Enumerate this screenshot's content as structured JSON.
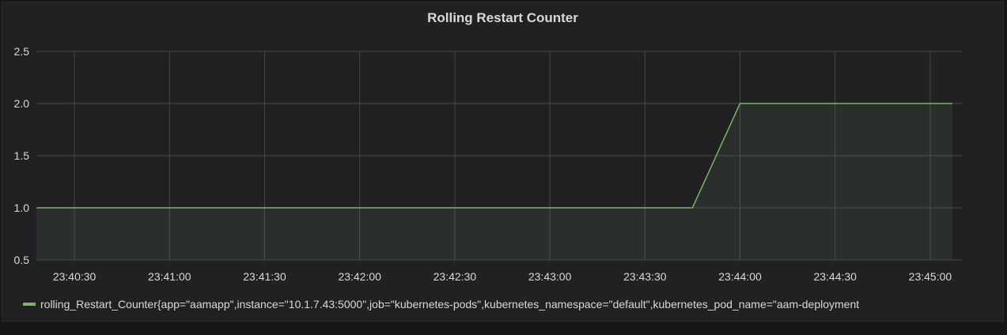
{
  "panel": {
    "title": "Rolling Restart Counter"
  },
  "colors": {
    "series": "#7eb26d",
    "grid": "#464648",
    "text": "#d8d9da"
  },
  "chart_data": {
    "type": "area",
    "title": "Rolling Restart Counter",
    "xlabel": "",
    "ylabel": "",
    "ylim": [
      0.5,
      2.5
    ],
    "y_ticks": [
      "0.5",
      "1.0",
      "1.5",
      "2.0",
      "2.5"
    ],
    "x_ticks": [
      "23:40:30",
      "23:41:00",
      "23:41:30",
      "23:42:00",
      "23:42:30",
      "23:43:00",
      "23:43:30",
      "23:44:00",
      "23:44:30",
      "23:45:00"
    ],
    "xlim": [
      "23:40:18",
      "23:45:10"
    ],
    "grid": true,
    "legend_position": "bottom",
    "series": [
      {
        "name": "rolling_Restart_Counter{app=\"aamapp\",instance=\"10.1.7.43:5000\",job=\"kubernetes-pods\",kubernetes_namespace=\"default\",kubernetes_pod_name=\"aam-deployment",
        "x": [
          "23:40:18",
          "23:43:45",
          "23:44:00",
          "23:45:07"
        ],
        "values": [
          1,
          1,
          2,
          2
        ]
      }
    ]
  }
}
